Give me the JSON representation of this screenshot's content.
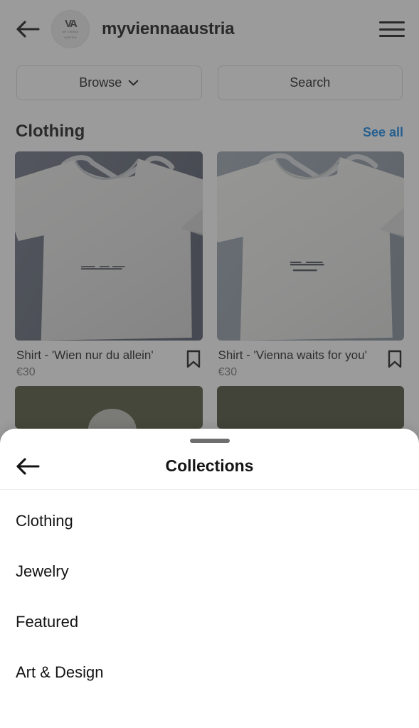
{
  "header": {
    "back_icon": "back-arrow-icon",
    "avatar_monogram": "VA",
    "avatar_sub": "MY VIENNA",
    "avatar_sub2": "AUSTRIA",
    "shop_name": "myviennaaustria",
    "menu_icon": "hamburger-menu-icon"
  },
  "filters": {
    "browse_label": "Browse",
    "browse_chevron": "chevron-down-icon",
    "search_label": "Search"
  },
  "section": {
    "title": "Clothing",
    "see_all_label": "See all",
    "see_all_color": "#0c83e8"
  },
  "products": [
    {
      "title": "Shirt - 'Wien nur du allein'",
      "price": "€30",
      "save_icon": "bookmark-icon",
      "bg_color": "#5d6370",
      "shirt_color": "#e8e8e6",
      "print": "wien nur du allein"
    },
    {
      "title": "Shirt - 'Vienna waits for you'",
      "price": "€30",
      "save_icon": "bookmark-icon",
      "bg_color": "#8c97a3",
      "shirt_color": "#f2f2f0",
      "print": "vienna waits for you"
    }
  ],
  "next_row": [
    {
      "bg_color": "#4c5036"
    },
    {
      "bg_color": "#464a34"
    }
  ],
  "sheet": {
    "grabber": "drag-handle",
    "back_icon": "back-arrow-icon",
    "title": "Collections",
    "items": [
      {
        "label": "Clothing"
      },
      {
        "label": "Jewelry"
      },
      {
        "label": "Featured"
      },
      {
        "label": "Art & Design"
      }
    ]
  }
}
